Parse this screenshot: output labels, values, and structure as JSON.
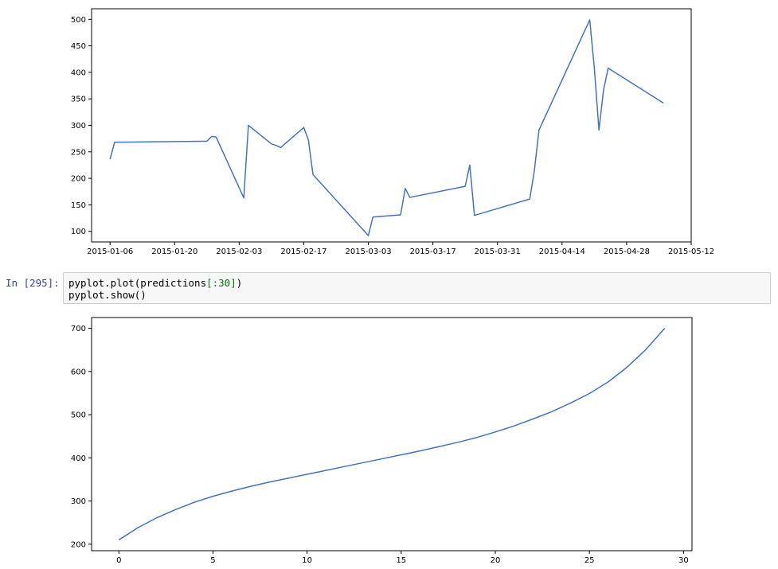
{
  "cell": {
    "prompt": "In [295]:",
    "code": {
      "line1_a": "pyplot.plot(predictions",
      "line1_b": "[:30]",
      "line1_c": ")",
      "line2": "pyplot.show()"
    }
  },
  "colors": {
    "line": "#4472c4",
    "axis": "#000000"
  },
  "chart_data": [
    {
      "type": "line",
      "title": "",
      "xlabel": "",
      "ylabel": "",
      "x_type": "date",
      "grid": false,
      "xlim": [
        "2015-01-02",
        "2015-05-12"
      ],
      "ylim": [
        80,
        520
      ],
      "x_ticks": [
        "2015-01-06",
        "2015-01-20",
        "2015-02-03",
        "2015-02-17",
        "2015-03-03",
        "2015-03-17",
        "2015-03-31",
        "2015-04-14",
        "2015-04-28",
        "2015-05-12"
      ],
      "y_ticks": [
        100,
        150,
        200,
        250,
        300,
        350,
        400,
        450,
        500
      ],
      "series": [
        {
          "x": [
            "2015-01-06",
            "2015-01-07",
            "2015-01-27",
            "2015-01-28",
            "2015-01-29",
            "2015-02-04",
            "2015-02-05",
            "2015-02-10",
            "2015-02-11",
            "2015-02-12",
            "2015-02-17",
            "2015-02-18",
            "2015-02-19",
            "2015-03-03",
            "2015-03-04",
            "2015-03-10",
            "2015-03-11",
            "2015-03-12",
            "2015-03-24",
            "2015-03-25",
            "2015-03-26",
            "2015-04-07",
            "2015-04-08",
            "2015-04-09",
            "2015-04-20",
            "2015-04-21",
            "2015-04-22",
            "2015-04-23",
            "2015-04-24",
            "2015-05-06"
          ],
          "y": [
            236,
            268,
            270,
            279,
            278,
            163,
            300,
            265,
            262,
            258,
            296,
            273,
            207,
            92,
            127,
            131,
            181,
            164,
            185,
            225,
            130,
            161,
            215,
            291,
            499,
            408,
            291,
            367,
            408,
            342
          ]
        }
      ]
    },
    {
      "type": "line",
      "title": "",
      "xlabel": "",
      "ylabel": "",
      "grid": false,
      "xlim": [
        -1.45,
        30.45
      ],
      "ylim": [
        185,
        725
      ],
      "x_ticks": [
        0,
        5,
        10,
        15,
        20,
        25,
        30
      ],
      "y_ticks": [
        200,
        300,
        400,
        500,
        600,
        700
      ],
      "series": [
        {
          "x": [
            0,
            1,
            2,
            3,
            4,
            5,
            6,
            7,
            8,
            9,
            10,
            11,
            12,
            13,
            14,
            15,
            16,
            17,
            18,
            19,
            20,
            21,
            22,
            23,
            24,
            25,
            26,
            27,
            28,
            29
          ],
          "y": [
            210,
            238,
            261,
            280,
            297,
            311,
            323,
            334,
            344,
            353,
            362,
            371,
            380,
            389,
            398,
            407,
            416,
            426,
            436,
            447,
            460,
            474,
            490,
            507,
            527,
            549,
            576,
            610,
            651,
            700
          ]
        }
      ]
    }
  ]
}
